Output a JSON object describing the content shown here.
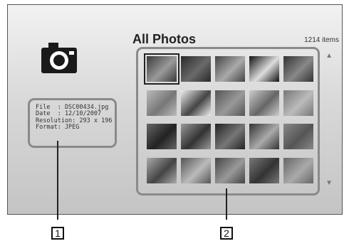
{
  "gallery": {
    "title": "All Photos",
    "item_count": "1214 items"
  },
  "info": {
    "file": "File  : DSC00434.jpg",
    "date": "Date  : 12/10/2007",
    "resolution": "Resolution: 293 x 196",
    "format": "Format: JPEG"
  },
  "callouts": {
    "one": "1",
    "two": "2"
  },
  "icons": {
    "camera": "camera-icon",
    "scroll_up": "scroll-up-arrow-icon",
    "scroll_down": "scroll-down-arrow-icon"
  },
  "colors": {
    "background_top": "#f2f2f2",
    "background_bottom": "#c4c4c4",
    "frame": "#8a8a8a"
  }
}
